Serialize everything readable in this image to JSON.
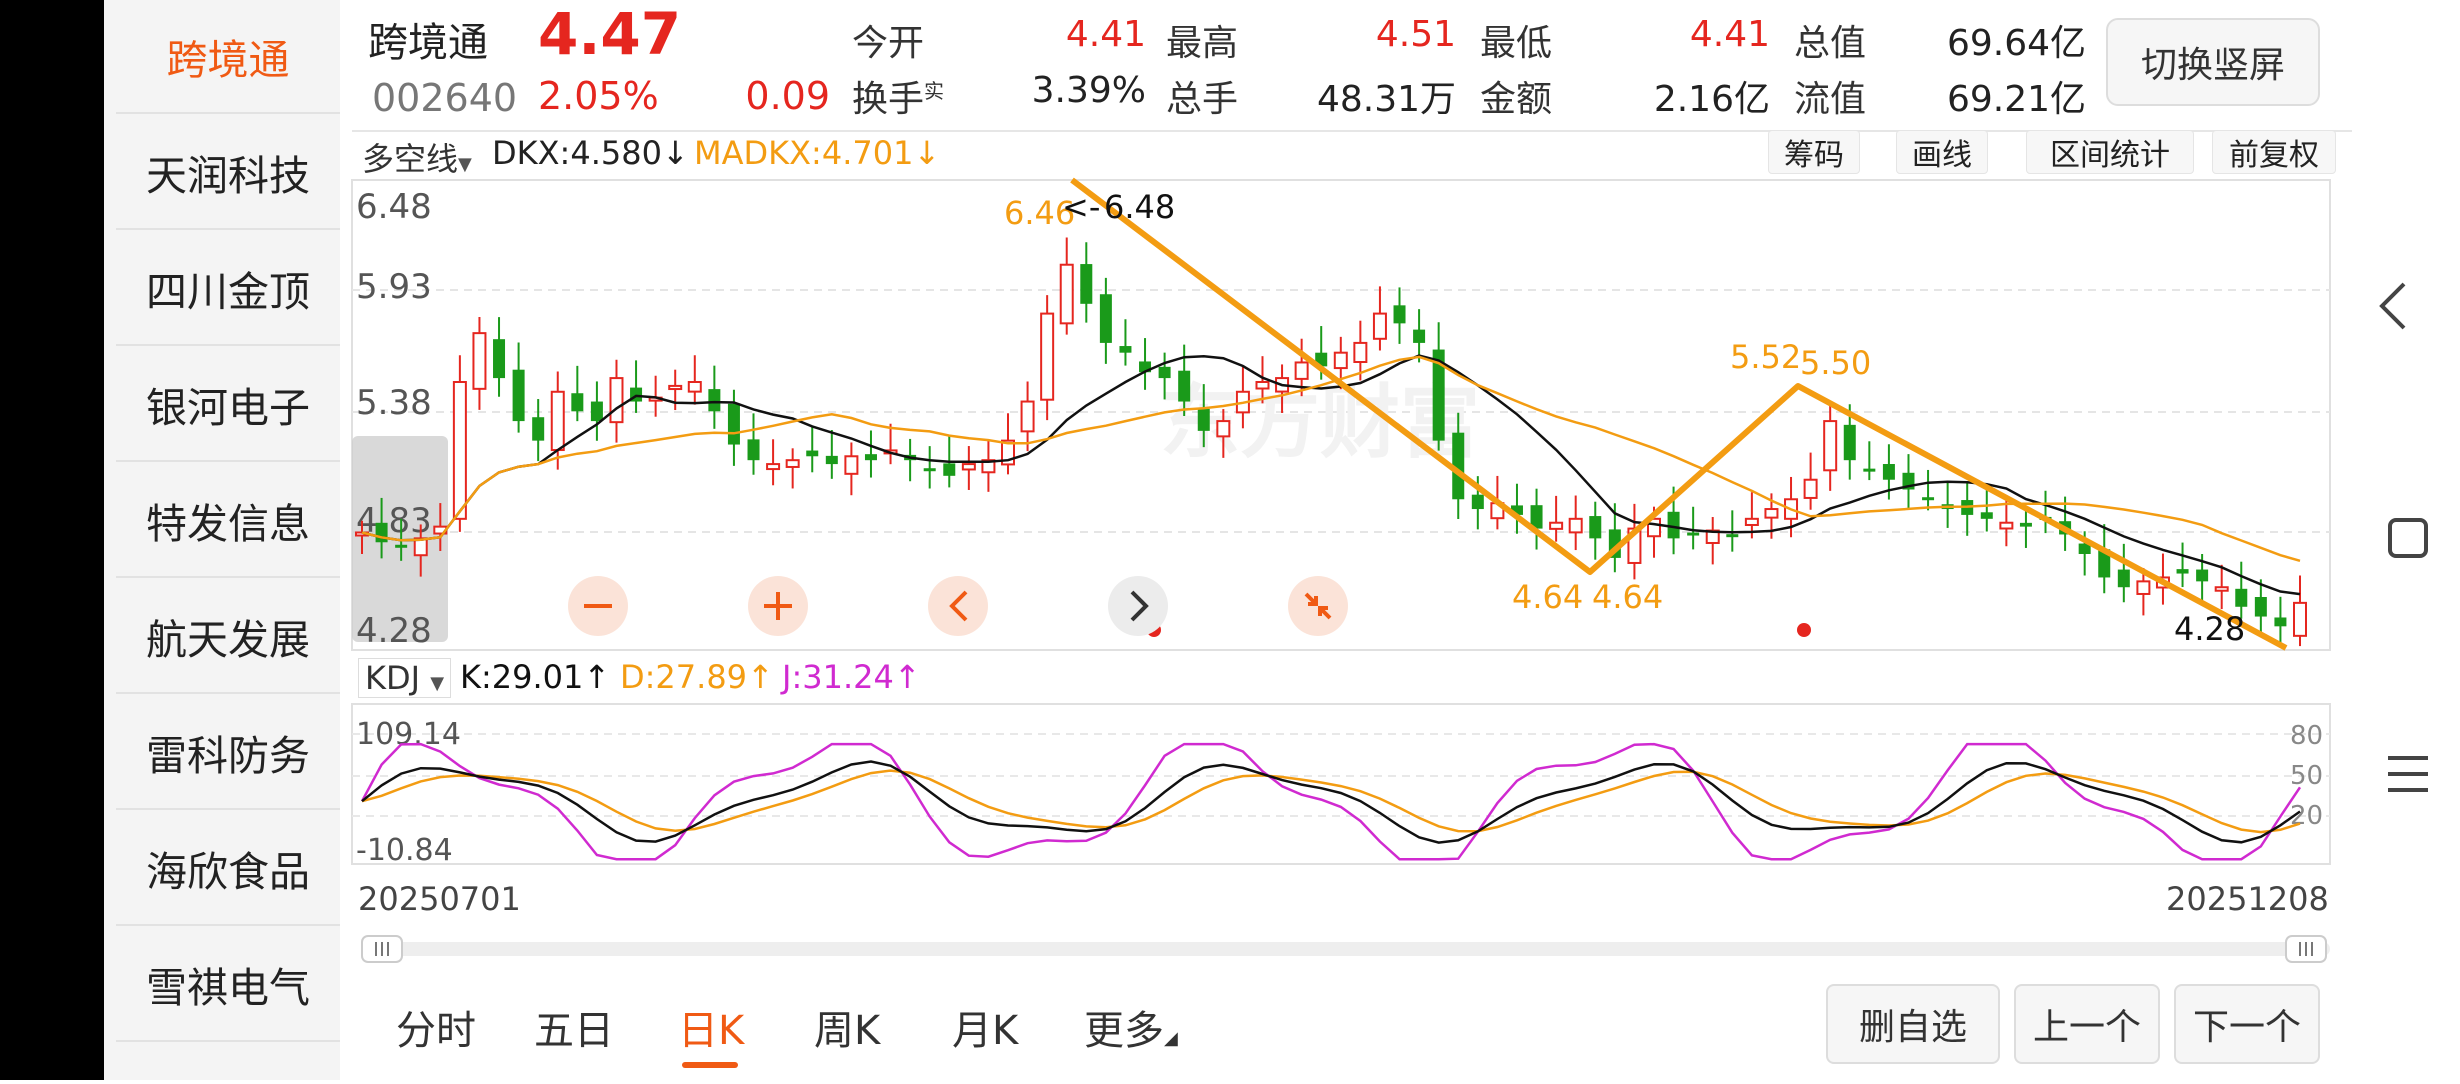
{
  "sidebar": {
    "items": [
      {
        "label": "跨境通",
        "active": true
      },
      {
        "label": "天润科技"
      },
      {
        "label": "四川金顶"
      },
      {
        "label": "银河电子"
      },
      {
        "label": "特发信息"
      },
      {
        "label": "航天发展"
      },
      {
        "label": "雷科防务"
      },
      {
        "label": "海欣食品"
      },
      {
        "label": "雪祺电气"
      }
    ]
  },
  "quote": {
    "name": "跨境通",
    "price": "4.47",
    "code": "002640",
    "change_pct": "2.05%",
    "change": "0.09",
    "open_label": "今开",
    "open": "4.41",
    "high_label": "最高",
    "high": "4.51",
    "low_label": "最低",
    "low": "4.41",
    "total_value_label": "总值",
    "total_value": "69.64亿",
    "turnover_label": "换手",
    "turnover_sup": "实",
    "turnover": "3.39%",
    "volume_label": "总手",
    "volume": "48.31万",
    "amount_label": "金额",
    "amount": "2.16亿",
    "float_value_label": "流值",
    "float_value": "69.21亿",
    "switch_button": "切换竖屏"
  },
  "indicator_bar": {
    "name": "多空线",
    "dkx": "DKX:4.580",
    "dkx_arrow": "↓",
    "madkx": "MADKX:4.701",
    "madkx_arrow": "↓",
    "buttons": [
      "筹码",
      "画线",
      "区间统计",
      "前复权"
    ]
  },
  "price_axis": [
    "6.48",
    "5.93",
    "5.38",
    "4.83",
    "4.28"
  ],
  "annotations": {
    "high_left": "6.46",
    "high_right": "6.48",
    "low1_left": "4.64",
    "low1_right": "4.64",
    "peak2_left": "5.52",
    "peak2_right": "5.50",
    "latest_low": "4.28"
  },
  "kdj": {
    "name": "KDJ",
    "k": "K:29.01",
    "k_arrow": "↑",
    "d": "D:27.89",
    "d_arrow": "↑",
    "j": "J:31.24",
    "j_arrow": "↑",
    "axis_top": "109.14",
    "axis_bottom": "-10.84",
    "levels": [
      "80",
      "50",
      "20"
    ]
  },
  "dates": {
    "start": "20250701",
    "end": "20251208"
  },
  "bottom_tabs": [
    "分时",
    "五日",
    "日K",
    "周K",
    "月K",
    "更多"
  ],
  "active_tab": "日K",
  "bottom_buttons": {
    "delete": "删自选",
    "prev": "上一个",
    "next": "下一个"
  },
  "watermark": "东方财富",
  "colors": {
    "up": "#e5261f",
    "down": "#1a9a1a",
    "accent": "#f05a14",
    "orange": "#f39c12",
    "magenta": "#d02ad0"
  }
}
